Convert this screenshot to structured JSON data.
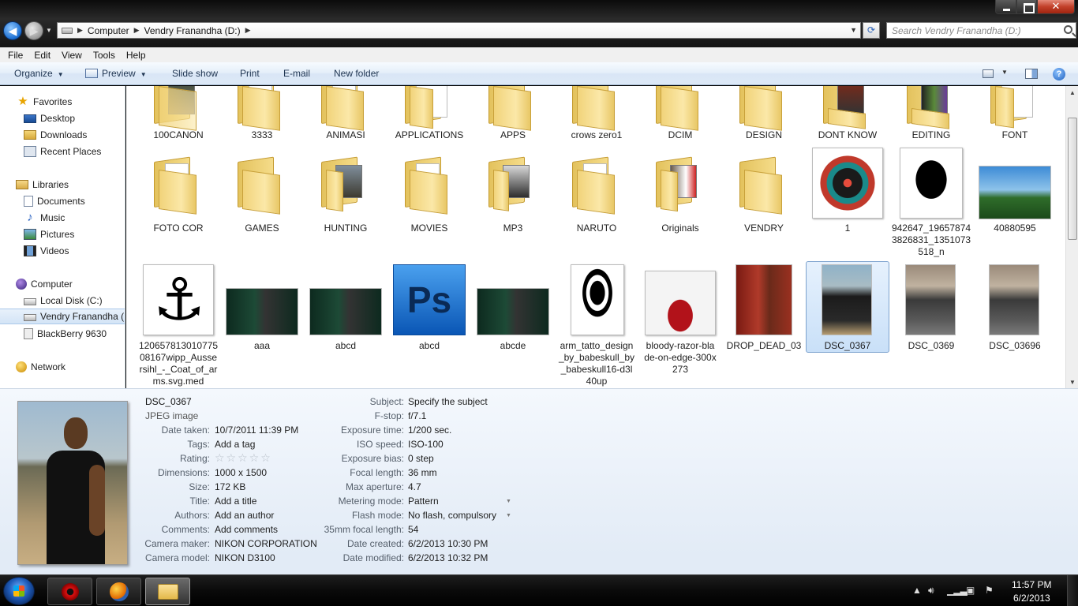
{
  "window": {
    "breadcrumbs": [
      "Computer",
      "Vendry Franandha (D:)"
    ],
    "search_placeholder": "Search Vendry Franandha (D:)"
  },
  "menubar": [
    "File",
    "Edit",
    "View",
    "Tools",
    "Help"
  ],
  "commandbar": {
    "organize": "Organize",
    "preview": "Preview",
    "slideshow": "Slide show",
    "print": "Print",
    "email": "E-mail",
    "newfolder": "New folder"
  },
  "navpane": {
    "favorites": "Favorites",
    "desktop": "Desktop",
    "downloads": "Downloads",
    "recent": "Recent Places",
    "libraries": "Libraries",
    "documents": "Documents",
    "music": "Music",
    "pictures": "Pictures",
    "videos": "Videos",
    "computer": "Computer",
    "localdisk": "Local Disk (C:)",
    "vendry": "Vendry Franandha (D",
    "blackberry": "BlackBerry 9630",
    "network": "Network"
  },
  "items_row1": [
    "100CANON",
    "3333",
    "ANIMASI",
    "APPLICATIONS",
    "APPS",
    "crows zero1",
    "DCIM",
    "DESIGN",
    "DONT KNOW",
    "EDITING",
    "FONT"
  ],
  "items_row2": [
    "FOTO COR",
    "GAMES",
    "HUNTING",
    "MOVIES",
    "MP3",
    "NARUTO",
    "Originals",
    "VENDRY",
    "1",
    "942647_196578743826831_1351073518_n",
    "40880595"
  ],
  "items_row3": [
    "1206578130107750 8167wipp_Aussersihl_-_Coat_of_arms.svg.med",
    "aaa",
    "abcd",
    "abcd",
    "abcde",
    "arm_tatto_design_by_babeskull_by_babeskull16-d3l40up",
    "bloody-razor-blade-on-edge-300x273",
    "DROP_DEAD_03",
    "DSC_0367",
    "DSC_0369",
    "DSC_03696"
  ],
  "row2_labels_wrapped": {
    "item10_line1": "942647_19657874",
    "item10_line2": "3826831_1351073",
    "item10_line3": "518_n"
  },
  "row3_labels_wrapped": {
    "item1_line1": "120657813010775",
    "item1_line2": "08167wipp_Ausse",
    "item1_line3": "rsihl_-_Coat_of_ar",
    "item1_line4": "ms.svg.med",
    "item6_line1": "arm_tatto_design",
    "item6_line2": "_by_babeskull_by",
    "item6_line3": "_babeskull16-d3l",
    "item6_line4": "40up",
    "item7_line1": "bloody-razor-bla",
    "item7_line2": "de-on-edge-300x",
    "item7_line3": "273"
  },
  "photoshop_glyph": "Ps",
  "details": {
    "filename": "DSC_0367",
    "filetype": "JPEG image",
    "left": [
      {
        "label": "Date taken:",
        "value": "10/7/2011 11:39 PM"
      },
      {
        "label": "Tags:",
        "value": "Add a tag"
      },
      {
        "label": "Rating:",
        "value": "☆☆☆☆☆"
      },
      {
        "label": "Dimensions:",
        "value": "1000 x 1500"
      },
      {
        "label": "Size:",
        "value": "172 KB"
      },
      {
        "label": "Title:",
        "value": "Add a title"
      },
      {
        "label": "Authors:",
        "value": "Add an author"
      },
      {
        "label": "Comments:",
        "value": "Add comments"
      },
      {
        "label": "Camera maker:",
        "value": "NIKON CORPORATION"
      },
      {
        "label": "Camera model:",
        "value": "NIKON D3100"
      }
    ],
    "right": [
      {
        "label": "Subject:",
        "value": "Specify the subject"
      },
      {
        "label": "F-stop:",
        "value": "f/7.1"
      },
      {
        "label": "Exposure time:",
        "value": "1/200 sec."
      },
      {
        "label": "ISO speed:",
        "value": "ISO-100"
      },
      {
        "label": "Exposure bias:",
        "value": "0 step"
      },
      {
        "label": "Focal length:",
        "value": "36 mm"
      },
      {
        "label": "Max aperture:",
        "value": "4.7"
      },
      {
        "label": "Metering mode:",
        "value": "Pattern"
      },
      {
        "label": "Flash mode:",
        "value": "No flash, compulsory"
      },
      {
        "label": "35mm focal length:",
        "value": "54"
      },
      {
        "label": "Date created:",
        "value": "6/2/2013 10:30 PM"
      },
      {
        "label": "Date modified:",
        "value": "6/2/2013 10:32 PM"
      }
    ]
  },
  "taskbar": {
    "time": "11:57 PM",
    "date": "6/2/2013"
  }
}
